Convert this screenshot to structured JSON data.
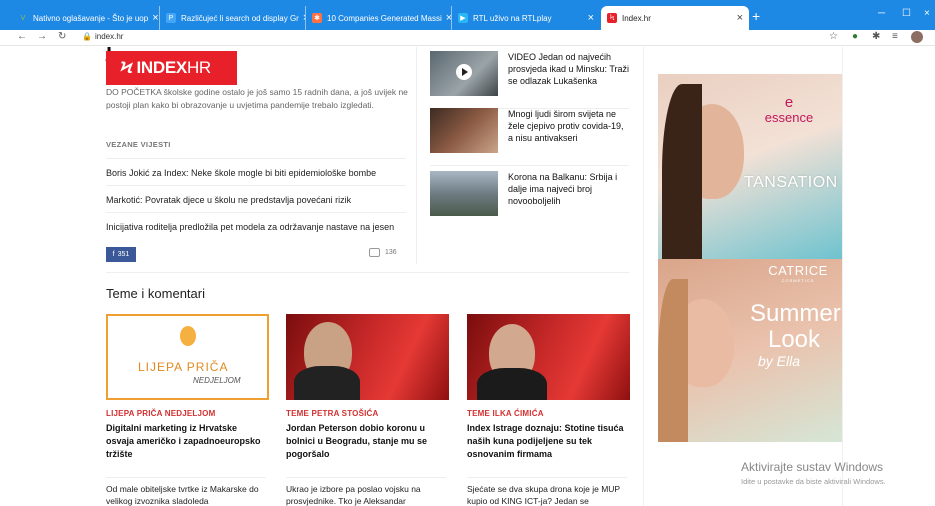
{
  "browser": {
    "tabs": [
      {
        "label": "Nativno oglašavanje - Što je uop",
        "icon": "v-icon",
        "color": "#4caf50"
      },
      {
        "label": "Različujeć li search od display Gr",
        "icon": "p-icon",
        "color": "#42a5f5"
      },
      {
        "label": "10 Companies Generated Massi",
        "icon": "hubspot-icon",
        "color": "#ff7043"
      },
      {
        "label": "RTL uživo na RTLplay",
        "icon": "rtl-icon",
        "color": "#29b6f6"
      },
      {
        "label": "Index.hr",
        "icon": "index-icon",
        "color": "#e8202a"
      }
    ],
    "url": "index.hr"
  },
  "logo": {
    "bolt": "Ϟ",
    "brand": "INDEX",
    "suffix": "HR"
  },
  "article": {
    "intro": "DO POČETKA školske godine ostalo je još samo 15 radnih dana, a još uvijek ne postoji plan kako bi obrazovanje u uvjetima pandemije trebalo izgledati.",
    "related_label": "VEZANE VIJESTI",
    "related": [
      "Boris Jokić za Index: Neke škole mogle bi biti epidemiološke bombe",
      "Markotić: Povratak djece u školu ne predstavlja povećani rizik",
      "Inicijativa roditelja predložila pet modela za održavanje nastave na jesen"
    ],
    "fb_count": "351",
    "comments_count": "136"
  },
  "side_news": [
    {
      "title": "VIDEO Jedan od najvećih prosvjeda ikad u Minsku: Traži se odlazak Lukašenka",
      "video": true
    },
    {
      "title": "Mnogi ljudi širom svijeta ne žele cjepivo protiv covida-19, a nisu antivakseri",
      "video": false
    },
    {
      "title": "Korona na Balkanu: Srbija i dalje ima najveći broj novooboljelih",
      "video": false
    }
  ],
  "section": {
    "title": "Teme i komentari",
    "cards": [
      {
        "category": "LIJEPA PRIČA NEDJELJOM",
        "headline": "Digitalni marketing iz Hrvatske osvaja američko i zapadnoeuropsko tržište",
        "sub": "Od male obiteljske tvrtke iz Makarske do velikog izvoznika sladoleda",
        "img_text1": "LIJEPA PRIČA",
        "img_text2": "NEDJELJOM"
      },
      {
        "category": "TEME PETRA STOŠIĆA",
        "headline": "Jordan Peterson dobio koronu u bolnici u Beogradu, stanje mu se pogoršalo",
        "sub": "Ukrao je izbore pa poslao vojsku na prosvjednike. Tko je Aleksandar"
      },
      {
        "category": "TEME ILKA ĆIMIĆA",
        "headline": "Index Istrage doznaju: Stotine tisuća naših kuna podijeljene su tek osnovanim firmama",
        "sub": "Sjećate se dva skupa drona koje je MUP kupio od KING ICT-ja? Jedan se"
      }
    ]
  },
  "ads": {
    "ad1_brand": "essence",
    "ad1_text": "TANSATION",
    "ad2_brand": "CATRICE",
    "ad2_brand_sub": "COSMETICS",
    "ad2_line1": "Summer",
    "ad2_line2": "Look",
    "ad2_by": "by Ella"
  },
  "watermark": {
    "title": "Aktivirajte sustav Windows",
    "sub": "Idite u postavke da biste aktivirali Windows."
  }
}
